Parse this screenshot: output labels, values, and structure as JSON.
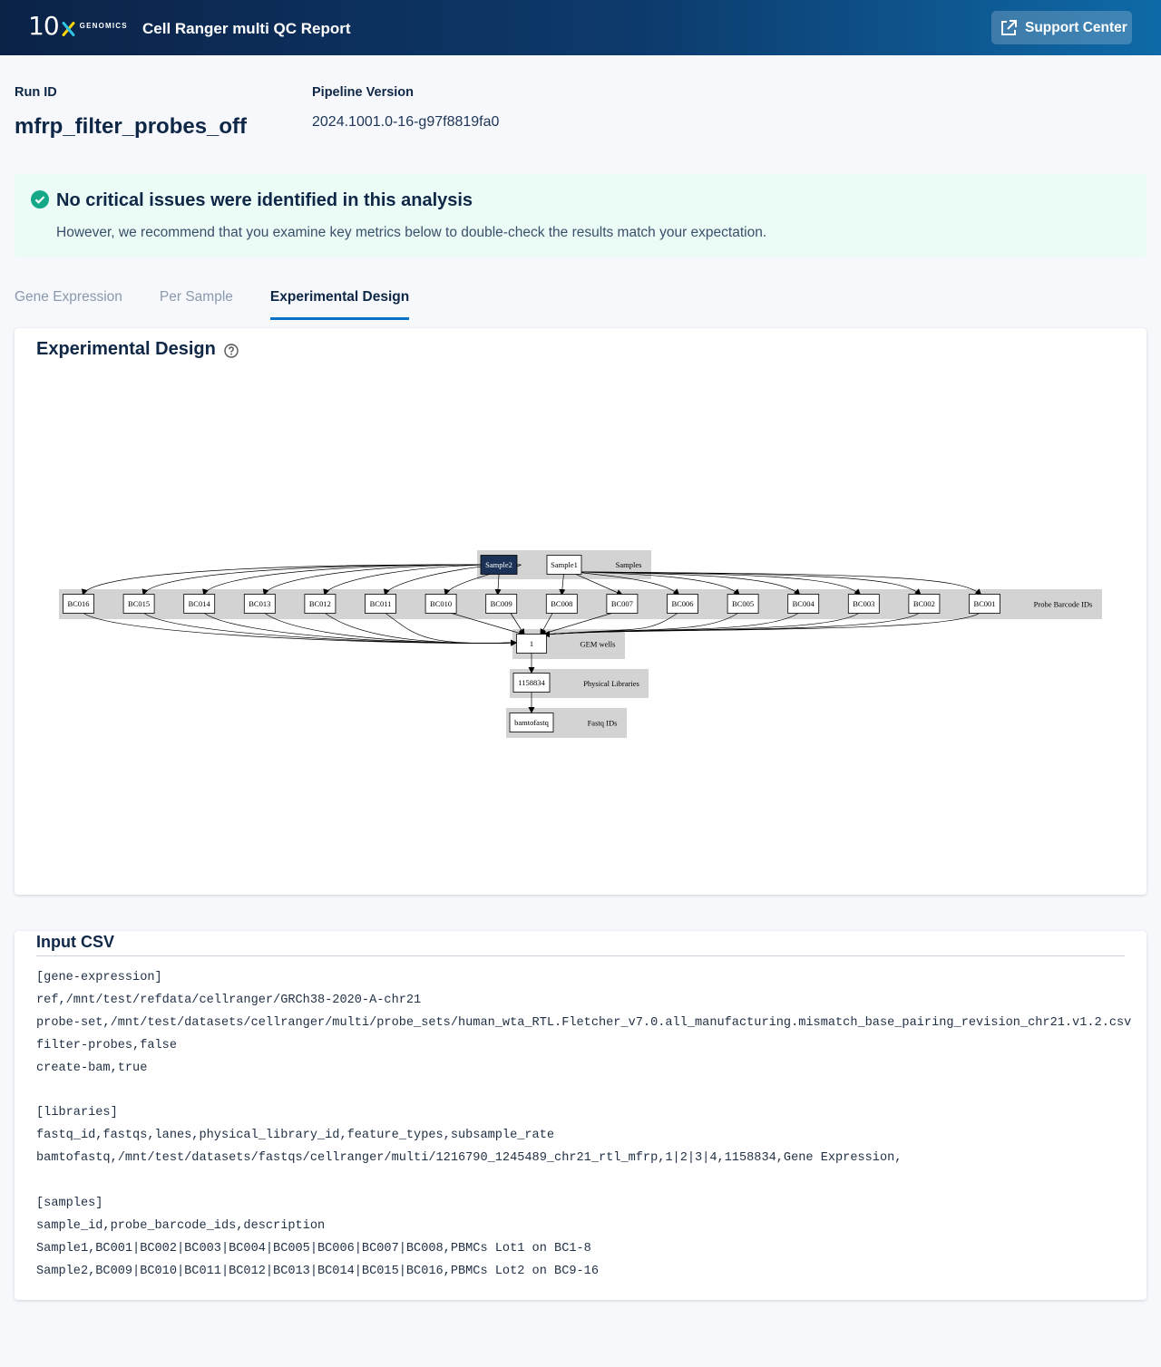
{
  "header": {
    "logo_number": "10",
    "logo_sub": "GENOMICS",
    "app_title": "Cell Ranger multi QC Report",
    "support_label": "Support Center"
  },
  "run": {
    "run_id_label": "Run ID",
    "run_id": "mfrp_filter_probes_off",
    "pipeline_label": "Pipeline Version",
    "pipeline_version": "2024.1001.0-16-g97f8819fa0"
  },
  "alert": {
    "title": "No critical issues were identified in this analysis",
    "body": "However, we recommend that you examine key metrics below to double-check the results match your expectation."
  },
  "tabs": [
    {
      "label": "Gene Expression",
      "active": false
    },
    {
      "label": "Per Sample",
      "active": false
    },
    {
      "label": "Experimental Design",
      "active": true
    }
  ],
  "design": {
    "title": "Experimental Design",
    "clusters": {
      "samples": "Samples",
      "probe_barcodes": "Probe Barcode IDs",
      "gem_wells": "GEM wells",
      "physical_libraries": "Physical Libraries",
      "fastq_ids": "Fastq IDs"
    },
    "samples": [
      "Sample2",
      "Sample1"
    ],
    "highlighted_sample": "Sample2",
    "probe_barcodes": [
      "BC016",
      "BC015",
      "BC014",
      "BC013",
      "BC012",
      "BC011",
      "BC010",
      "BC009",
      "BC008",
      "BC007",
      "BC006",
      "BC005",
      "BC004",
      "BC003",
      "BC002",
      "BC001"
    ],
    "gem_well": "1",
    "physical_library": "1158834",
    "fastq_id": "bamtofastq"
  },
  "input_csv": {
    "title": "Input CSV",
    "lines": [
      "[gene-expression]",
      "ref,/mnt/test/refdata/cellranger/GRCh38-2020-A-chr21",
      "probe-set,/mnt/test/datasets/cellranger/multi/probe_sets/human_wta_RTL.Fletcher_v7.0.all_manufacturing.mismatch_base_pairing_revision_chr21.v1.2.csv",
      "filter-probes,false",
      "create-bam,true",
      "",
      "[libraries]",
      "fastq_id,fastqs,lanes,physical_library_id,feature_types,subsample_rate",
      "bamtofastq,/mnt/test/datasets/fastqs/cellranger/multi/1216790_1245489_chr21_rtl_mfrp,1|2|3|4,1158834,Gene Expression,",
      "",
      "[samples]",
      "sample_id,probe_barcode_ids,description",
      "Sample1,BC001|BC002|BC003|BC004|BC005|BC006|BC007|BC008,PBMCs Lot1 on BC1-8",
      "Sample2,BC009|BC010|BC011|BC012|BC013|BC014|BC015|BC016,PBMCs Lot2 on BC9-16"
    ]
  },
  "colors": {
    "header_start": "#0b2247",
    "header_end": "#0e6aa8",
    "tab_accent": "#0a72c6",
    "alert_bg": "#ebfbf6",
    "success": "#14a889",
    "highlight_node": "#1b3155",
    "cluster_bg": "#d3d3d3"
  }
}
